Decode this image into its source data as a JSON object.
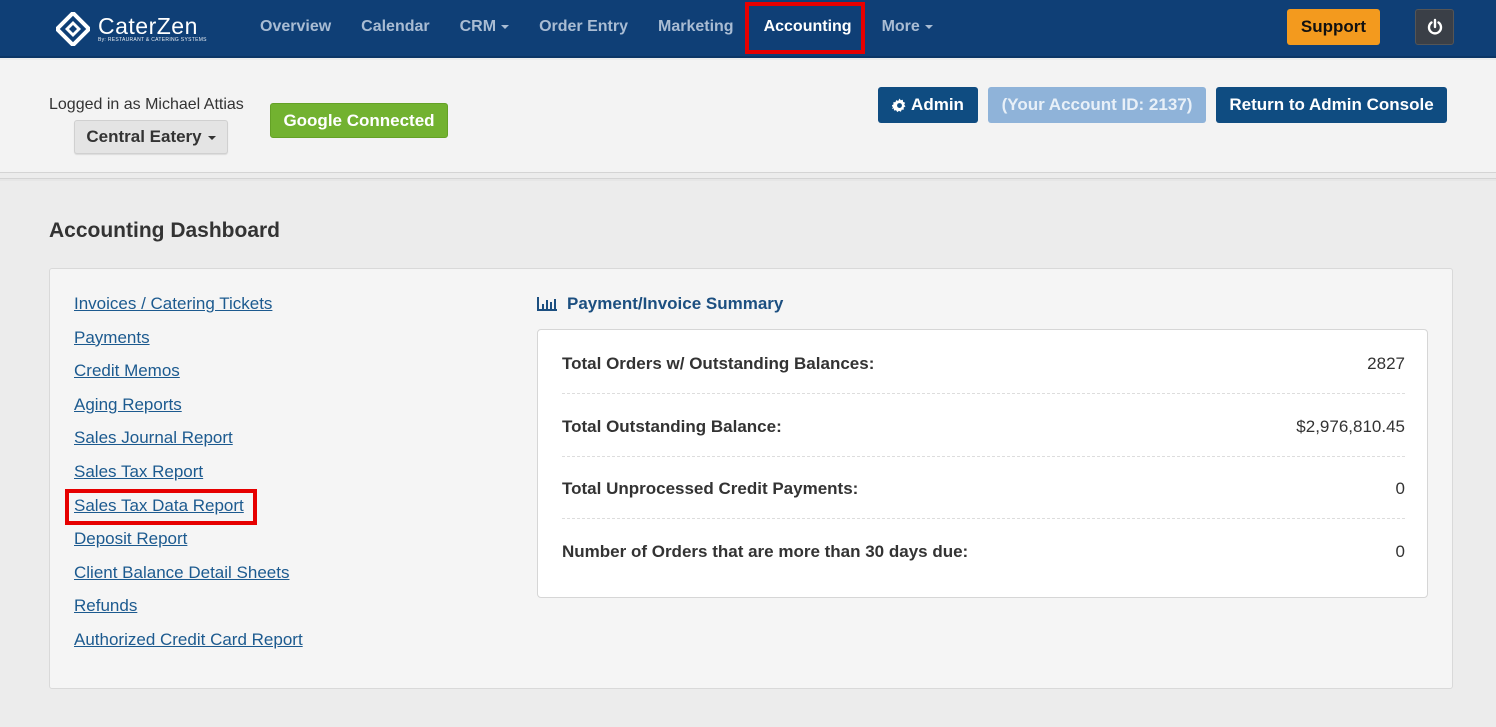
{
  "brand": {
    "name": "CaterZen",
    "tagline": "By: RESTAURANT & CATERING SYSTEMS"
  },
  "nav": {
    "items": [
      {
        "label": "Overview"
      },
      {
        "label": "Calendar"
      },
      {
        "label": "CRM"
      },
      {
        "label": "Order Entry"
      },
      {
        "label": "Marketing"
      },
      {
        "label": "Accounting"
      },
      {
        "label": "More"
      }
    ],
    "active": "Accounting",
    "support_label": "Support",
    "power_icon": "power-icon"
  },
  "account": {
    "logged_in_text": "Logged in as Michael Attias",
    "location": "Central Eatery",
    "google_label": "Google Connected",
    "admin_label": "Admin",
    "account_id_label": "(Your Account ID: 2137)",
    "return_label": "Return to Admin Console"
  },
  "main": {
    "title": "Accounting Dashboard",
    "links": [
      "Invoices / Catering Tickets",
      "Payments",
      "Credit Memos",
      "Aging Reports",
      "Sales Journal Report",
      "Sales Tax Report",
      "Sales Tax Data Report",
      "Deposit Report",
      "Client Balance Detail Sheets",
      "Refunds",
      "Authorized Credit Card Report"
    ],
    "highlighted_link": "Sales Tax Data Report",
    "summary": {
      "title": "Payment/Invoice Summary",
      "rows": [
        {
          "label": "Total Orders w/ Outstanding Balances:",
          "value": "2827"
        },
        {
          "label": "Total Outstanding Balance:",
          "value": "$2,976,810.45"
        },
        {
          "label": "Total Unprocessed Credit Payments:",
          "value": "0"
        },
        {
          "label": "Number of Orders that are more than 30 days due:",
          "value": "0"
        }
      ]
    }
  },
  "colors": {
    "nav_bg": "#0f3f76",
    "highlight": "#e60000",
    "support": "#f39a1e",
    "google": "#72b230",
    "primary": "#0f4c81",
    "link": "#1c5a8f"
  }
}
